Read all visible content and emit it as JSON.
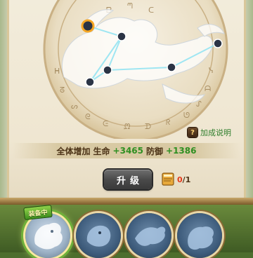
{
  "explain_link": {
    "icon": "?",
    "label": "加成说明"
  },
  "bonus": {
    "prefix": "全体增加",
    "hp_label": "生命",
    "hp_value": "+3465",
    "def_label": "防御",
    "def_value": "+1386"
  },
  "upgrade": {
    "label": "升级"
  },
  "material": {
    "icon": "book-icon",
    "have": "0",
    "separator": "/",
    "need": "1"
  },
  "slots": {
    "selected_tag": "装备中",
    "items": [
      {
        "name": "slot-1",
        "icon": "dragon-icon"
      },
      {
        "name": "slot-2",
        "icon": "lion-icon"
      },
      {
        "name": "slot-3",
        "icon": "bird-icon"
      },
      {
        "name": "slot-4",
        "icon": "dragon-icon"
      }
    ]
  },
  "colors": {
    "accent_green": "#2e8f21",
    "warning_red": "#e23a1b",
    "active_star": "#f5a623"
  }
}
